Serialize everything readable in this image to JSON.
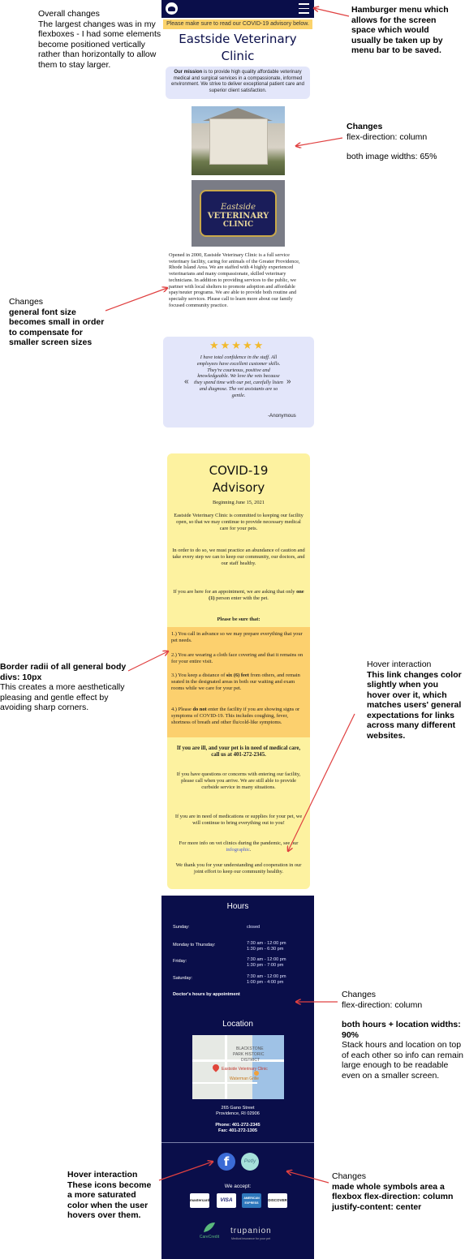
{
  "annotations": {
    "overall": {
      "title": "Overall changes",
      "body": "The largest changes was in my flexboxes - I had some elements become positioned vertically rather than horizontally to allow them to stay larger."
    },
    "hamburger": {
      "title": "Hamburger menu which allows for the screen space which would usually be taken up by menu bar to be saved."
    },
    "images": {
      "title": "Changes",
      "line1": "flex-direction: column",
      "line2": "both image widths: 65%"
    },
    "font": {
      "title": "Changes",
      "body": "general font size becomes small in order to compensate for smaller screen sizes"
    },
    "border": {
      "title": "Border radii of all general body divs: 10px",
      "body": "This creates a more aesthetically pleasing and gentle effect by avoiding sharp corners."
    },
    "hover_link": {
      "title": "Hover interaction",
      "body": "This link changes color slightly when you hover over it, which matches users' general expectations for links across many different websites."
    },
    "hours_changes": {
      "title": "Changes",
      "line1": "flex-direction: column",
      "line2_bold": "both hours + location widths: 90%",
      "body": "Stack hours and location on top of each other so info can remain large enough to be readable even on a smaller screen."
    },
    "hover_icons": {
      "title": "Hover interaction",
      "body": "These icons become a more saturated color when the user hovers over them."
    },
    "symbols": {
      "title": "Changes",
      "body": "made whole symbols area a flexbox flex-direction: column justify-content: center"
    }
  },
  "site": {
    "advisory_bar": "Please make sure to read our COVID-19 advisory below.",
    "clinic_title_1": "Eastside Veterinary",
    "clinic_title_2": "Clinic",
    "mission_bold": "Our mission",
    "mission_text": " is to provide high quality affordable veterinary medical and surgical services in a compassionate, informed environment. We strive to deliver exceptional patient care and superior client satisfaction.",
    "sign_line1": "Eastside",
    "sign_line2": "VETERINARY",
    "sign_line3": "CLINIC",
    "about": "Opened in 2000, Eastside Veterinary Clinic is a full service veterinary facility, caring for animals of the Greater Providence, Rhode Island Area. We are staffed with 4 highly experienced veterinarians and many compassionate, skilled veterinary technicians. In addition to providing services to the public, we partner with local shelters to promote adoption and affordable spay/neuter programs. We are able to provide both routine and specialty services. Please call to learn more about our family focused  community practice.",
    "stars": "★★★★★",
    "review": "I have total confidence in the staff. All employees have excellent customer skills. They're courteous, positive and knowledgeable. We love the vets because they spend time with our pet, carefully listen and diagnose. The vet assistants are so gentle.",
    "review_prev": "«",
    "review_next": "»",
    "review_author": "-Anonymous"
  },
  "covid": {
    "title_1": "COVID-19",
    "title_2": "Advisory",
    "beginning": "Beginning June 15, 2021",
    "p1": "Eastside Veterinary Clinic is committed to keeping our facility open, so that we may continue to provide necessary medical care for your pets.",
    "p2": "In order to do so, we must practice an abundance of caution and take every step we can to keep our community, our doctors, and our staff healthy.",
    "p3a": "If you are here for an appointment, we are asking that only ",
    "p3b": "one (1)",
    "p3c": " person enter with the pet.",
    "be_sure": "Please be sure that:",
    "r1": "1.) You call in advance so we may prepare everything that your pet needs.",
    "r2": "2.) You are wearing a cloth face covering and that it remains on for your entire visit.",
    "r3a": "3.) You keep a distance of ",
    "r3b": "six (6) feet",
    "r3c": " from others, and remain seated in the designated areas in both our waiting and exam rooms while we care for your pet.",
    "r4a": "4.) Please ",
    "r4b": "do not",
    "r4c": " enter the facility if you are showing signs or symptoms of COVID-19. This includes coughing, fever, shortness of breath and other flu/cold-like symptoms.",
    "ill": "If you are ill, and your pet is in need of medical care, call us at 401-272-2345.",
    "q1": "If you have questions or concerns with entering our facility, please call when you arrive. We are still able to provide curbside service in many situations.",
    "q2": "If you are in need of medications or supplies for your pet, we will continue to bring everything out to you!",
    "q3a": "For more info on vet clinics during the pandemic, see our ",
    "q3_link": "infographic",
    "q3c": ".",
    "q4": "We thank you for your understanding and cooperation in our joint effort to keep our community healthy."
  },
  "hours": {
    "title": "Hours",
    "rows": [
      {
        "day": "Sunday:",
        "time1": "closed",
        "time2": ""
      },
      {
        "day": "Monday to Thursday:",
        "time1": "7:30 am - 12:00 pm",
        "time2": "1:30 pm - 6:30 pm"
      },
      {
        "day": "Friday:",
        "time1": "7:30 am - 12:00 pm",
        "time2": "1:30 pm - 7:00 pm"
      },
      {
        "day": "Saturday:",
        "time1": "7:30 am - 12:00 pm",
        "time2": "1:00 pm - 4:00 pm"
      }
    ],
    "doctor_note": "Doctor's hours by appointment"
  },
  "location": {
    "title": "Location",
    "map_label_1": "BLACKSTONE",
    "map_label_2": "PARK HISTORIC",
    "map_label_3": "DISTRICT",
    "map_pin_label": "Eastside Veterinary Clinic",
    "map_grill": "Waterman Grille",
    "address_1": "265 Gano Street",
    "address_2": "Providence, RI  02906",
    "phone": "Phone: 401-272-2345",
    "fax": "Fax: 401-272-1305"
  },
  "footer": {
    "facebook_glyph": "f",
    "petly": "Petly",
    "we_accept": "We accept:",
    "cards": [
      "mastercard",
      "VISA",
      "AMERICAN EXPRESS",
      "DISCOVER"
    ],
    "carecredit": "CareCredit",
    "trupanion": "trupanion",
    "trupanion_sub": "Medical insurance for your pet"
  },
  "colors": {
    "navy": "#0a0e4a",
    "yellow": "#fdf2a0",
    "gold": "#fcd06e",
    "lavender": "#e3e6fa",
    "arrow": "#e04040",
    "link": "#4a5bd1"
  }
}
